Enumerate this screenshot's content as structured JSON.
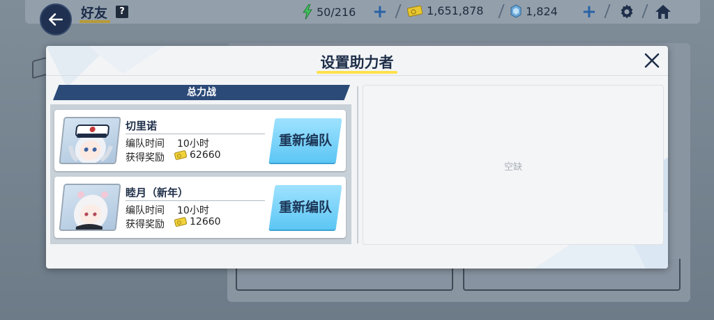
{
  "header": {
    "back_icon": "arrow-left-icon",
    "title": "好友",
    "help_icon": "question-icon",
    "resources": {
      "ap": {
        "icon": "lightning-icon",
        "value": "50/216"
      },
      "credit": {
        "icon": "credit-ticket-icon",
        "value": "1,651,878"
      },
      "gem": {
        "icon": "pyroxene-gem-icon",
        "value": "1,824"
      }
    },
    "plus_label": "+",
    "settings_icon": "gear-icon",
    "home_icon": "home-icon"
  },
  "modal": {
    "title": "设置助力者",
    "close_icon": "close-icon",
    "section_title": "总力战",
    "assists": [
      {
        "name": "切里诺",
        "time_label": "编队时间",
        "time_value": "10小时",
        "reward_label": "获得奖励",
        "reward_value": "62660",
        "button_label": "重新编队"
      },
      {
        "name": "睦月（新年）",
        "time_label": "编队时间",
        "time_value": "10小时",
        "reward_label": "获得奖励",
        "reward_value": "12660",
        "button_label": "重新编队"
      }
    ],
    "empty_slot_label": "空缺"
  },
  "colors": {
    "navy": "#2b4a78",
    "button_blue": "#5cc6f4",
    "title_underline": "#ffe24a",
    "credit_gold": "#e8c730"
  }
}
